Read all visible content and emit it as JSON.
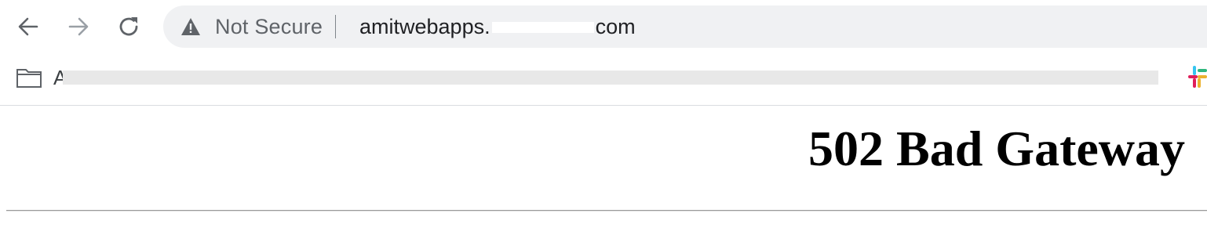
{
  "browser": {
    "nav": {
      "back_icon": "arrow-left-icon",
      "forward_icon": "arrow-right-icon",
      "reload_icon": "reload-icon",
      "forward_enabled": false
    },
    "omnibox": {
      "security_icon": "warning-triangle-icon",
      "security_label": "Not Secure",
      "url_prefix": "amitwebapps.",
      "url_suffix": "com"
    },
    "bookmarks": {
      "folder_icon": "folder-icon",
      "folder_label": "A",
      "extension_icon": "slack-icon"
    }
  },
  "page": {
    "title": "502 Bad Gateway"
  },
  "colors": {
    "omnibox_bg": "#f0f1f3",
    "icon": "#5f6368",
    "icon_disabled": "#9aa0a6",
    "text": "#202124"
  }
}
